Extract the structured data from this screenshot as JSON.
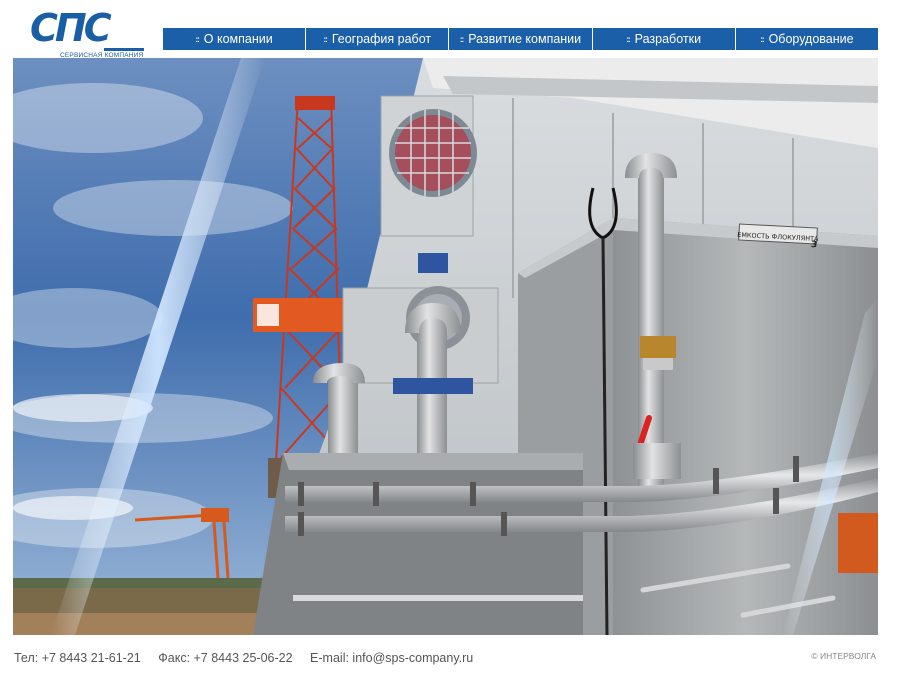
{
  "logo": {
    "text": "СПС",
    "subtitle": "СЕРВИСНАЯ КОМПАНИЯ"
  },
  "nav": {
    "bullet": "::",
    "items": [
      {
        "label": "О компании"
      },
      {
        "label": "География работ"
      },
      {
        "label": "Развитие компании"
      },
      {
        "label": "Разработки"
      },
      {
        "label": "Оборудование"
      }
    ]
  },
  "hero": {
    "tank_label": "ЕМКОСТЬ ФЛОКУЛЯНТА",
    "tank_number": "3"
  },
  "footer": {
    "phone": "Тел: +7 8443 21-61-21",
    "fax": "Факс: +7 8443 25-06-22",
    "email": "E-mail: info@sps-company.ru",
    "copyright": "© ИНТЕРВОЛГА"
  },
  "colors": {
    "brand": "#1a5fa7",
    "sky": "#3d6aa8",
    "rig": "#c8381e"
  }
}
